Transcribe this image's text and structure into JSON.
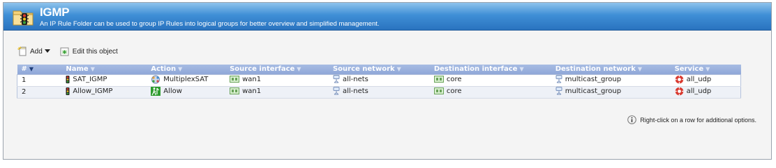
{
  "header": {
    "title": "IGMP",
    "description": "An IP Rule Folder can be used to group IP Rules into logical groups for better overview and simplified management.",
    "icon": "traffic-light-folder-icon"
  },
  "toolbar": {
    "add_label": "Add",
    "edit_label": "Edit this object"
  },
  "table": {
    "columns": [
      "#",
      "Name",
      "Action",
      "Source interface",
      "Source network",
      "Destination interface",
      "Destination network",
      "Service"
    ],
    "rows": [
      {
        "index": "1",
        "name": "SAT_IGMP",
        "action": "MultiplexSAT",
        "action_icon": "multiplex-icon",
        "src_if": "wan1",
        "src_net": "all-nets",
        "dst_if": "core",
        "dst_net": "multicast_group",
        "service": "all_udp"
      },
      {
        "index": "2",
        "name": "Allow_IGMP",
        "action": "Allow",
        "action_icon": "allow-icon",
        "src_if": "wan1",
        "src_net": "all-nets",
        "dst_if": "core",
        "dst_net": "multicast_group",
        "service": "all_udp"
      }
    ]
  },
  "hint": "Right-click on a row for additional options.",
  "colors": {
    "banner": "#3f8fd6",
    "header_row": "#8fa7d8",
    "accent_green": "#2e9b2e"
  }
}
